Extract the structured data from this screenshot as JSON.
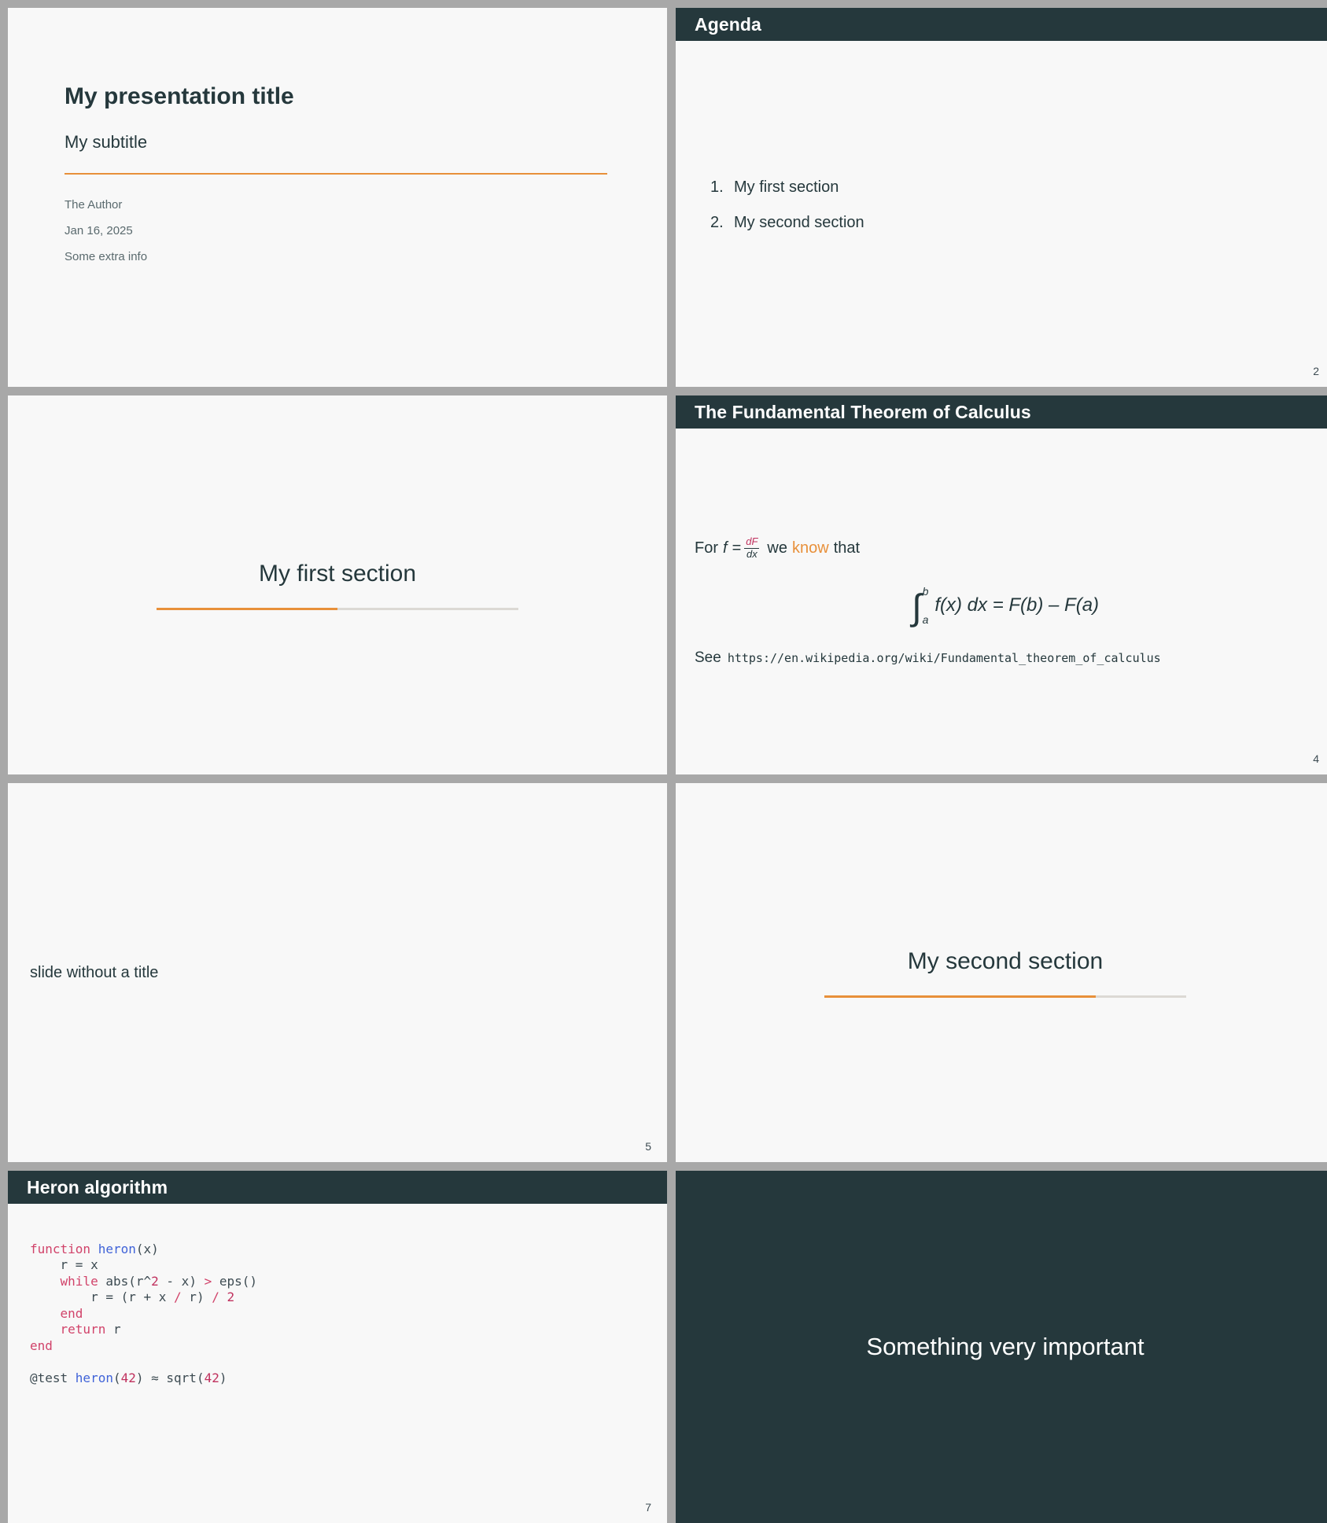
{
  "theme": {
    "accent": "#e8903a",
    "dark": "#25383c",
    "slide_bg": "#f8f8f8",
    "page_bg": "#a8a8a8",
    "muted_text": "#5a6a6e"
  },
  "slides": [
    {
      "kind": "title",
      "title": "My presentation title",
      "subtitle": "My subtitle",
      "author": "The Author",
      "date": "Jan 16, 2025",
      "extra": "Some extra info"
    },
    {
      "kind": "agenda",
      "header": "Agenda",
      "items": [
        {
          "number": "1.",
          "label": "My first section"
        },
        {
          "number": "2.",
          "label": "My second section"
        }
      ],
      "page": "2"
    },
    {
      "kind": "section",
      "title": "My first section",
      "progress_percent": 50
    },
    {
      "kind": "math",
      "header": "The Fundamental Theorem of Calculus",
      "intro_before": "For",
      "intro_f": "f",
      "intro_eq": "=",
      "frac_num": "dF",
      "frac_den": "dx",
      "intro_we": "we",
      "intro_know": "know",
      "intro_that": "that",
      "equation_upper": "b",
      "equation_lower": "a",
      "equation_body": "f(x) dx = F(b) – F(a)",
      "see_label": "See",
      "see_url": "https://en.wikipedia.org/wiki/Fundamental_theorem_of_calculus",
      "page": "4"
    },
    {
      "kind": "untitled",
      "text": "slide without a title",
      "page": "5"
    },
    {
      "kind": "section",
      "title": "My second section",
      "progress_percent": 75
    },
    {
      "kind": "code",
      "header": "Heron algorithm",
      "language": "julia",
      "lines": [
        "function heron(x)",
        "    r = x",
        "    while abs(r^2 - x) > eps()",
        "        r = (r + x / r) / 2",
        "    end",
        "    return r",
        "end",
        "",
        "@test heron(42) ≈ sqrt(42)"
      ],
      "page": "7"
    },
    {
      "kind": "statement",
      "text": "Something very important"
    }
  ]
}
